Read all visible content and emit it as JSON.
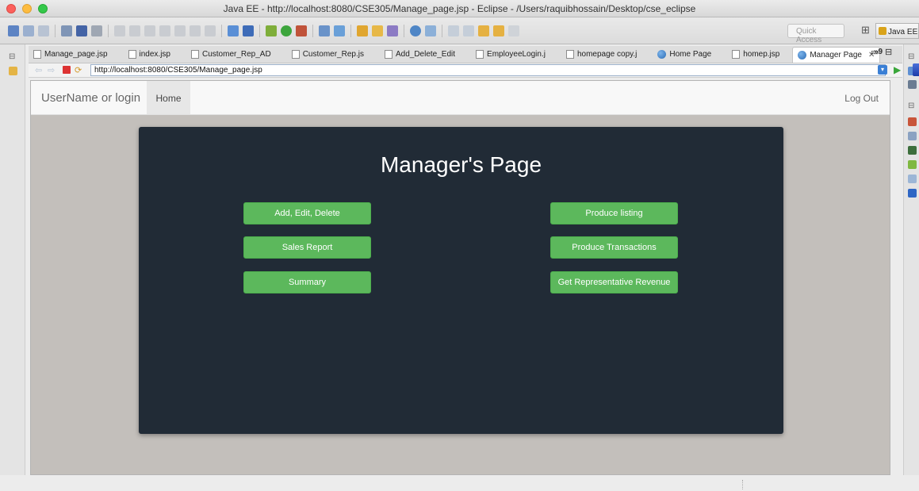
{
  "window": {
    "title": "Java EE - http://localhost:8080/CSE305/Manage_page.jsp - Eclipse - /Users/raquibhossain/Desktop/cse_eclipse"
  },
  "toolbar": {
    "quick_access_placeholder": "Quick Access",
    "perspective_label": "Java EE"
  },
  "tabs": {
    "items": [
      {
        "label": "Manage_page.jsp",
        "icon": "file-icon"
      },
      {
        "label": "index.jsp",
        "icon": "file-icon"
      },
      {
        "label": "Customer_Rep_AD",
        "icon": "file-icon"
      },
      {
        "label": "Customer_Rep.js",
        "icon": "file-icon"
      },
      {
        "label": "Add_Delete_Edit",
        "icon": "file-icon"
      },
      {
        "label": "EmployeeLogin.j",
        "icon": "file-icon"
      },
      {
        "label": "homepage copy.j",
        "icon": "file-icon"
      },
      {
        "label": "Home Page",
        "icon": "globe-icon"
      },
      {
        "label": "homep.jsp",
        "icon": "file-icon"
      },
      {
        "label": "Manager Page",
        "icon": "globe-icon",
        "active": true
      }
    ],
    "close_glyph": "✕",
    "overflow_label": "»9"
  },
  "browser": {
    "url": "http://localhost:8080/CSE305/Manage_page.jsp"
  },
  "page": {
    "brand": "UserName or login",
    "nav_home": "Home",
    "logout": "Log Out",
    "title": "Manager's Page",
    "buttons_left": [
      "Add, Edit, Delete",
      "Sales Report",
      "Summary"
    ],
    "buttons_right": [
      "Produce listing",
      "Produce Transactions",
      "Get Representative Revenue"
    ],
    "accent_color": "#5cb85c",
    "panel_color": "#212b36"
  }
}
